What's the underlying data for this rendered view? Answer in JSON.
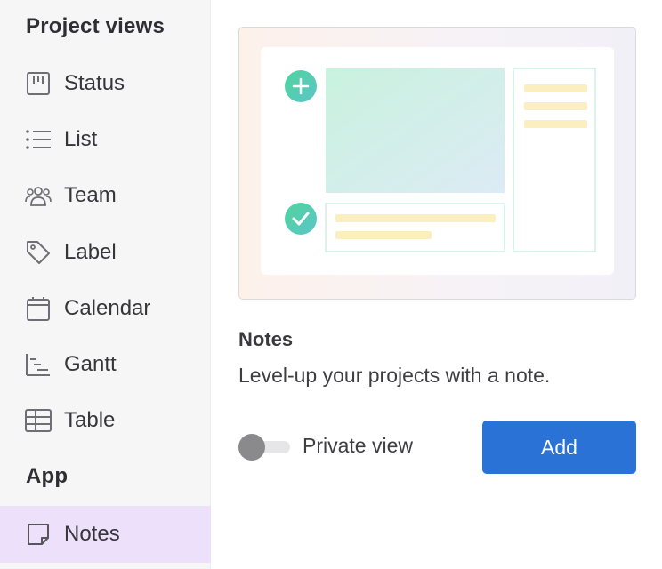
{
  "sidebar": {
    "project_views_title": "Project views",
    "items": [
      {
        "label": "Status",
        "icon": "status-board-icon"
      },
      {
        "label": "List",
        "icon": "list-icon"
      },
      {
        "label": "Team",
        "icon": "team-icon"
      },
      {
        "label": "Label",
        "icon": "tag-icon"
      },
      {
        "label": "Calendar",
        "icon": "calendar-icon"
      },
      {
        "label": "Gantt",
        "icon": "gantt-chart-icon"
      },
      {
        "label": "Table",
        "icon": "table-icon"
      }
    ],
    "app_title": "App",
    "app_items": [
      {
        "label": "Notes",
        "icon": "note-icon",
        "active": true
      }
    ]
  },
  "detail": {
    "title": "Notes",
    "description": "Level-up your projects with a note.",
    "toggle": {
      "label": "Private view",
      "on": false
    },
    "add_label": "Add"
  },
  "colors": {
    "accent": "#2a72d5",
    "active_bg": "#ece0fb",
    "sidebar_bg": "#f6f6f7",
    "preview_green": "#4dcfa0",
    "preview_yellow": "#fbefbf"
  }
}
